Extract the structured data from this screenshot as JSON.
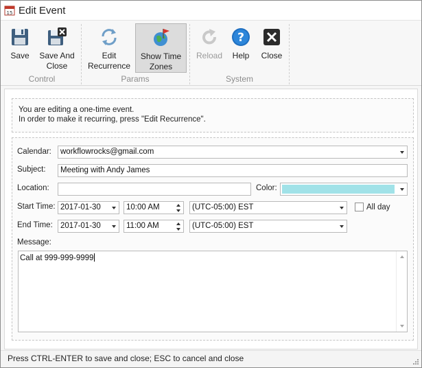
{
  "window": {
    "title": "Edit Event",
    "title_icon": "calendar-icon"
  },
  "ribbon": {
    "buttons": {
      "save": {
        "label": "Save",
        "icon": "floppy-disk-icon"
      },
      "save_and_close": {
        "label": "Save And\nClose",
        "icon": "floppy-disk-close-icon"
      },
      "edit_recurrence": {
        "label": "Edit\nRecurrence",
        "icon": "recurrence-arrows-icon"
      },
      "show_time_zones": {
        "label": "Show Time\nZones",
        "icon": "globe-flag-icon",
        "active": true
      },
      "reload": {
        "label": "Reload",
        "icon": "reload-icon",
        "disabled": true
      },
      "help": {
        "label": "Help",
        "icon": "help-icon"
      },
      "close": {
        "label": "Close",
        "icon": "close-icon"
      }
    },
    "groups": {
      "control": "Control",
      "params": "Params",
      "system": "System"
    }
  },
  "info": {
    "line1": "You are editing a one-time event.",
    "line2": "In order to make it recurring, press \"Edit Recurrence\"."
  },
  "form": {
    "calendar_label": "Calendar:",
    "calendar_value": "workflowrocks@gmail.com",
    "subject_label": "Subject:",
    "subject_value": "Meeting with Andy James",
    "location_label": "Location:",
    "location_value": "",
    "color_label": "Color:",
    "color_value": "#a1e2e8",
    "start_label": "Start Time:",
    "start_date": "2017-01-30",
    "start_time": "10:00 AM",
    "start_tz": "(UTC-05:00) EST",
    "all_day_label": "All day",
    "all_day_checked": false,
    "end_label": "End Time:",
    "end_date": "2017-01-30",
    "end_time": "11:00 AM",
    "end_tz": "(UTC-05:00) EST",
    "message_label": "Message:",
    "message_value": "Call at 999-999-9999"
  },
  "status": {
    "text": "Press CTRL-ENTER to save and close; ESC to cancel and close"
  }
}
